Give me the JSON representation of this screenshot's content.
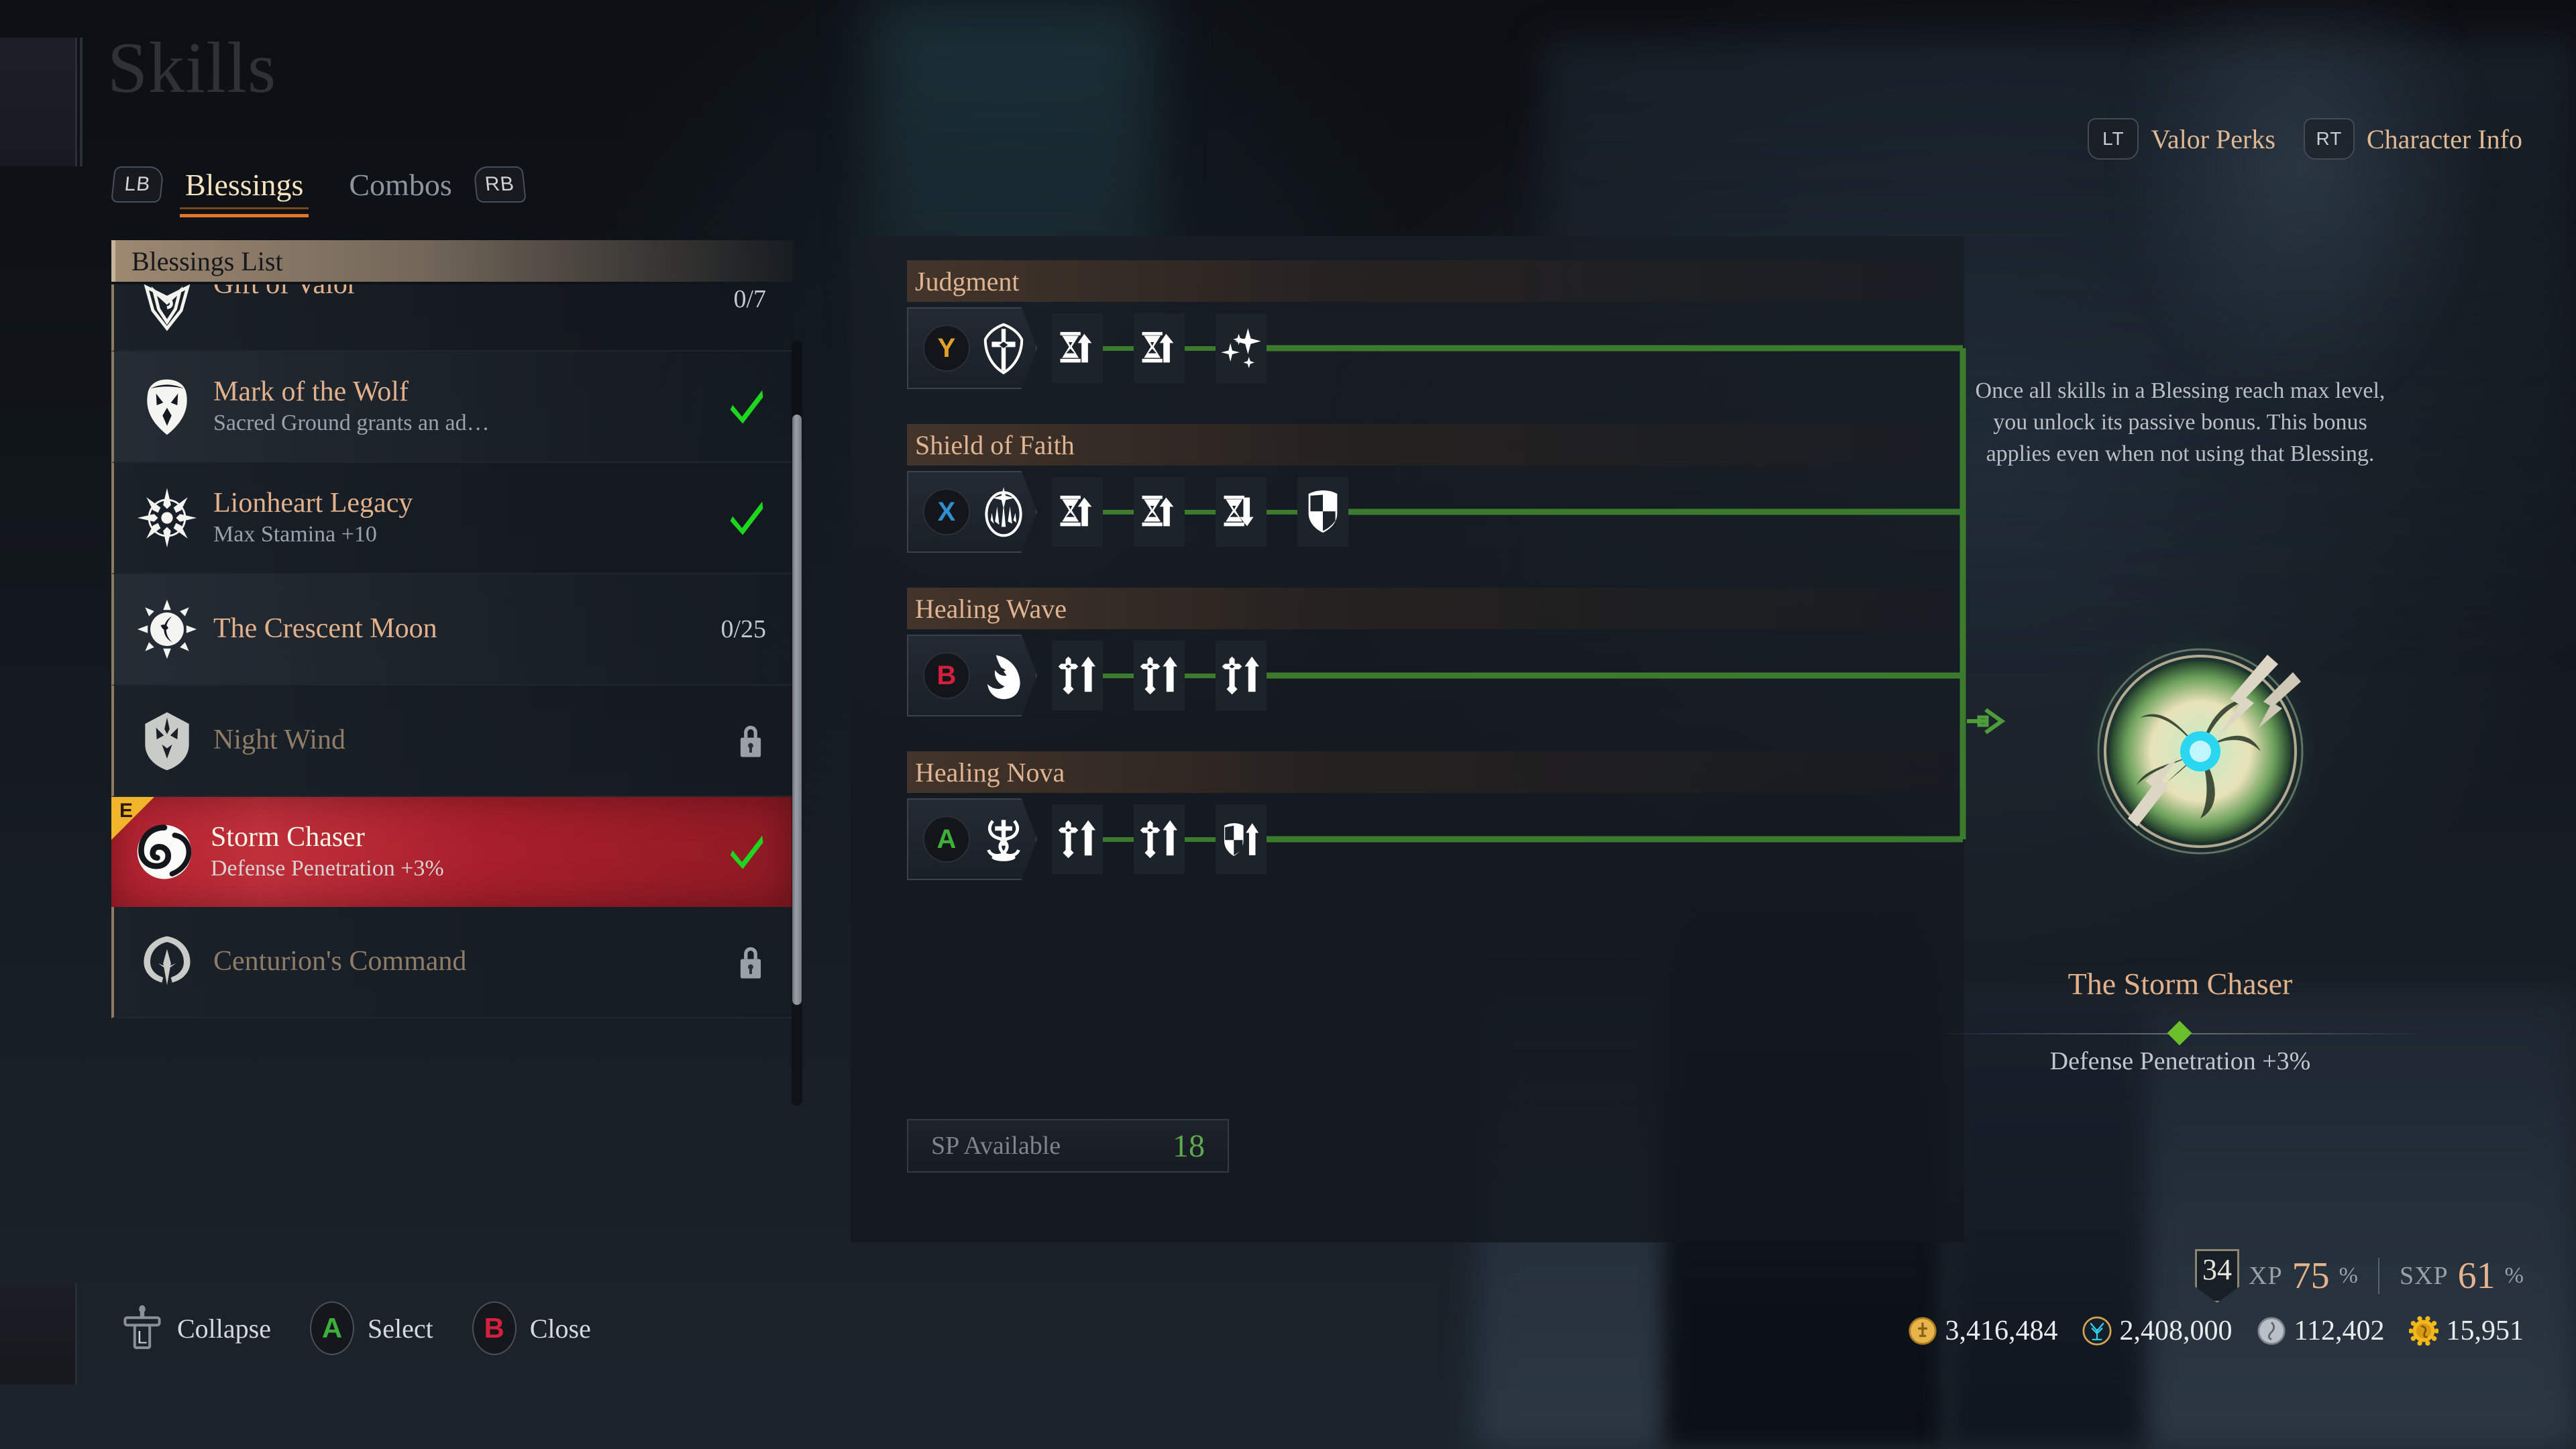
{
  "header": {
    "title": "Skills",
    "tabs": [
      {
        "badge": "LB",
        "label": "Blessings",
        "active": true
      },
      {
        "badge": "RB",
        "label": "Combos",
        "active": false
      }
    ],
    "nav_right": [
      {
        "badge": "LT",
        "label": "Valor Perks"
      },
      {
        "badge": "RT",
        "label": "Character Info"
      }
    ]
  },
  "sidebar": {
    "header": "Blessings List",
    "items": [
      {
        "name": "Gift of Valor",
        "sub": "",
        "right_type": "progress",
        "right": "0/7",
        "state": "normal",
        "icon": "chevron-crest-icon"
      },
      {
        "name": "Mark of the Wolf",
        "sub": "Sacred Ground grants an ad…",
        "right_type": "check",
        "right": "",
        "state": "normal",
        "icon": "wolf-head-icon"
      },
      {
        "name": "Lionheart Legacy",
        "sub": "Max Stamina +10",
        "right_type": "check",
        "right": "",
        "state": "normal",
        "icon": "sunburst-icon"
      },
      {
        "name": "The Crescent Moon",
        "sub": "",
        "right_type": "progress",
        "right": "0/25",
        "state": "normal",
        "icon": "crescent-sun-icon"
      },
      {
        "name": "Night Wind",
        "sub": "",
        "right_type": "lock",
        "right": "",
        "state": "locked",
        "icon": "moth-crest-icon"
      },
      {
        "name": "Storm Chaser",
        "sub": "Defense Penetration +3%",
        "right_type": "check",
        "right": "",
        "state": "selected",
        "icon": "storm-swirl-icon",
        "tag": "E"
      },
      {
        "name": "Centurion's Command",
        "sub": "",
        "right_type": "lock",
        "right": "",
        "state": "locked",
        "icon": "laurel-crest-icon"
      }
    ]
  },
  "skill_tree": {
    "groups": [
      {
        "title": "Judgment",
        "button": "Y",
        "button_color": "#e0a02a",
        "base_icon": "cross-shield-icon",
        "nodes": [
          "hourglass-up-icon",
          "hourglass-up-icon",
          "sparkles-icon"
        ]
      },
      {
        "title": "Shield of Faith",
        "button": "X",
        "button_color": "#2f8fd0",
        "base_icon": "orb-burst-icon",
        "nodes": [
          "hourglass-up-icon",
          "hourglass-up-icon",
          "hourglass-down-icon",
          "shield-quarter-icon"
        ]
      },
      {
        "title": "Healing Wave",
        "button": "B",
        "button_color": "#d4203c",
        "base_icon": "wave-flame-icon",
        "nodes": [
          "cross-up-icon",
          "cross-up-icon",
          "cross-up-icon"
        ]
      },
      {
        "title": "Healing Nova",
        "button": "A",
        "button_color": "#3fae3a",
        "base_icon": "serpent-cross-icon",
        "nodes": [
          "cross-up-icon",
          "cross-up-icon",
          "shield-up-icon"
        ]
      }
    ],
    "sp": {
      "label": "SP Available",
      "value": "18"
    },
    "connector_color": "#3c7a2e"
  },
  "detail": {
    "passive_note": "Once all skills in a Blessing reach max level, you unlock its passive bonus. This bonus applies even when not using that Blessing.",
    "blessing_name": "The Storm Chaser",
    "blessing_effect": "Defense Penetration +3%",
    "emblem_icon": "storm-emblem-icon"
  },
  "footer": {
    "hints": [
      {
        "badge": "L",
        "badge_type": "stick",
        "label": "Collapse"
      },
      {
        "badge": "A",
        "badge_type": "circle",
        "color": "#3fae3a",
        "label": "Select"
      },
      {
        "badge": "B",
        "badge_type": "circle",
        "color": "#d4203c",
        "label": "Close"
      }
    ]
  },
  "stats": {
    "level": "34",
    "xp_label": "XP",
    "xp_value": "75",
    "xp_unit": "%",
    "sxp_label": "SXP",
    "sxp_value": "61",
    "sxp_unit": "%",
    "currencies": [
      {
        "icon": "gold-coin-icon",
        "color": "#e0a83a",
        "value": "3,416,484"
      },
      {
        "icon": "tree-token-icon",
        "color": "#29b6d8",
        "value": "2,408,000"
      },
      {
        "icon": "silver-coin-icon",
        "color": "#aab2ba",
        "value": "112,402"
      },
      {
        "icon": "gear-coin-icon",
        "color": "#f2b71a",
        "value": "15,951"
      }
    ]
  }
}
